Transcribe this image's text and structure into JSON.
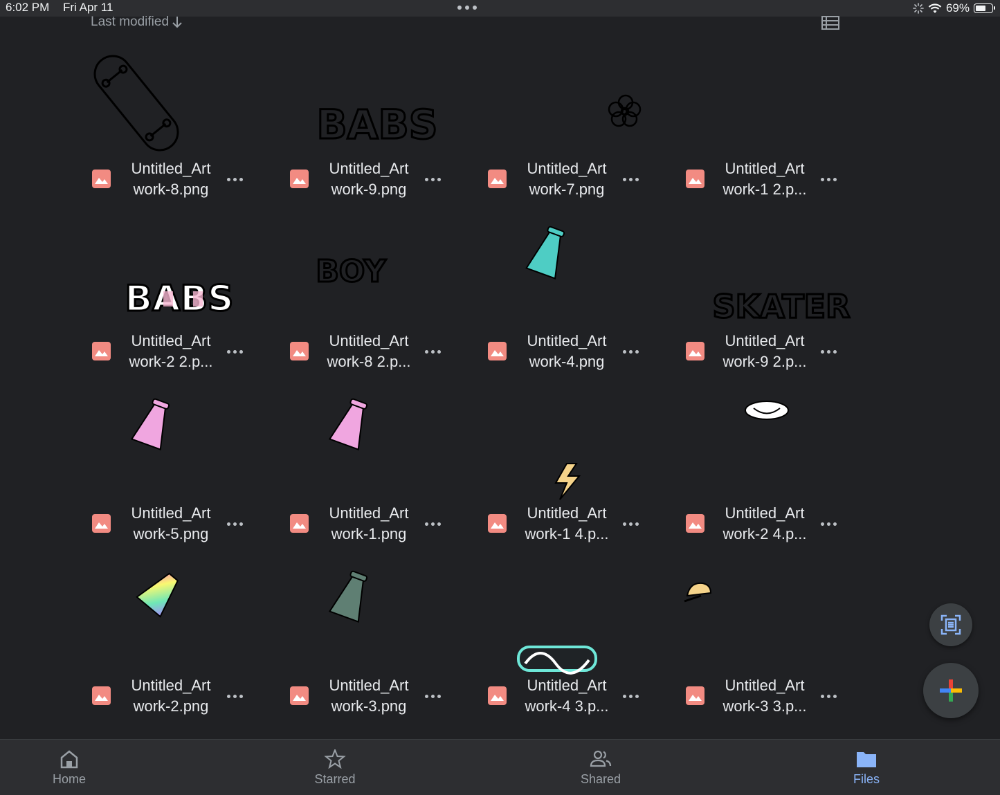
{
  "status_bar": {
    "time": "6:02 PM",
    "date": "Fri Apr 11",
    "battery": "69%",
    "battery_level": 0.69
  },
  "sort": {
    "label": "Last modified",
    "direction_icon": "arrow-down-icon"
  },
  "view_toggle_icon": "list-view-icon",
  "files": [
    {
      "name": "Untitled_Art\nwork-8.png",
      "thumb": "skateboard-outline"
    },
    {
      "name": "Untitled_Art\nwork-9.png",
      "thumb": "babs-outline-lettering"
    },
    {
      "name": "Untitled_Art\nwork-7.png",
      "thumb": "flower-outline"
    },
    {
      "name": "Untitled_Art\nwork-1 2.p...",
      "thumb": "blank"
    },
    {
      "name": "Untitled_Art\nwork-2 2.p...",
      "thumb": "babs-color-lettering"
    },
    {
      "name": "Untitled_Art\nwork-8 2.p...",
      "thumb": "boy-outline-lettering"
    },
    {
      "name": "Untitled_Art\nwork-4.png",
      "thumb": "teal-skateboard-sticker"
    },
    {
      "name": "Untitled_Art\nwork-9 2.p...",
      "thumb": "skater-outline-lettering"
    },
    {
      "name": "Untitled_Art\nwork-5.png",
      "thumb": "pink-skateboard-sticker"
    },
    {
      "name": "Untitled_Art\nwork-1.png",
      "thumb": "pink-skateboard-sticker"
    },
    {
      "name": "Untitled_Art\nwork-1 4.p...",
      "thumb": "lightning-bolt"
    },
    {
      "name": "Untitled_Art\nwork-2 4.p...",
      "thumb": "white-smiley-sticker"
    },
    {
      "name": "Untitled_Art\nwork-2.png",
      "thumb": "rainbow-skateboard-sticker"
    },
    {
      "name": "Untitled_Art\nwork-3.png",
      "thumb": "gray-skateboard-sticker"
    },
    {
      "name": "Untitled_Art\nwork-4 3.p...",
      "thumb": "vans-logo-sticker"
    },
    {
      "name": "Untitled_Art\nwork-3 3.p...",
      "thumb": "cap-sticker"
    }
  ],
  "fab": {
    "scan_icon": "document-scan-icon",
    "new_icon": "plus-icon"
  },
  "bottom_nav": [
    {
      "label": "Home",
      "icon": "home-icon",
      "active": false
    },
    {
      "label": "Starred",
      "icon": "star-icon",
      "active": false
    },
    {
      "label": "Shared",
      "icon": "people-icon",
      "active": false
    },
    {
      "label": "Files",
      "icon": "folder-icon",
      "active": true
    }
  ],
  "colors": {
    "background": "#202124",
    "file_icon": "#f28b82",
    "active_tab": "#8ab4f8"
  }
}
